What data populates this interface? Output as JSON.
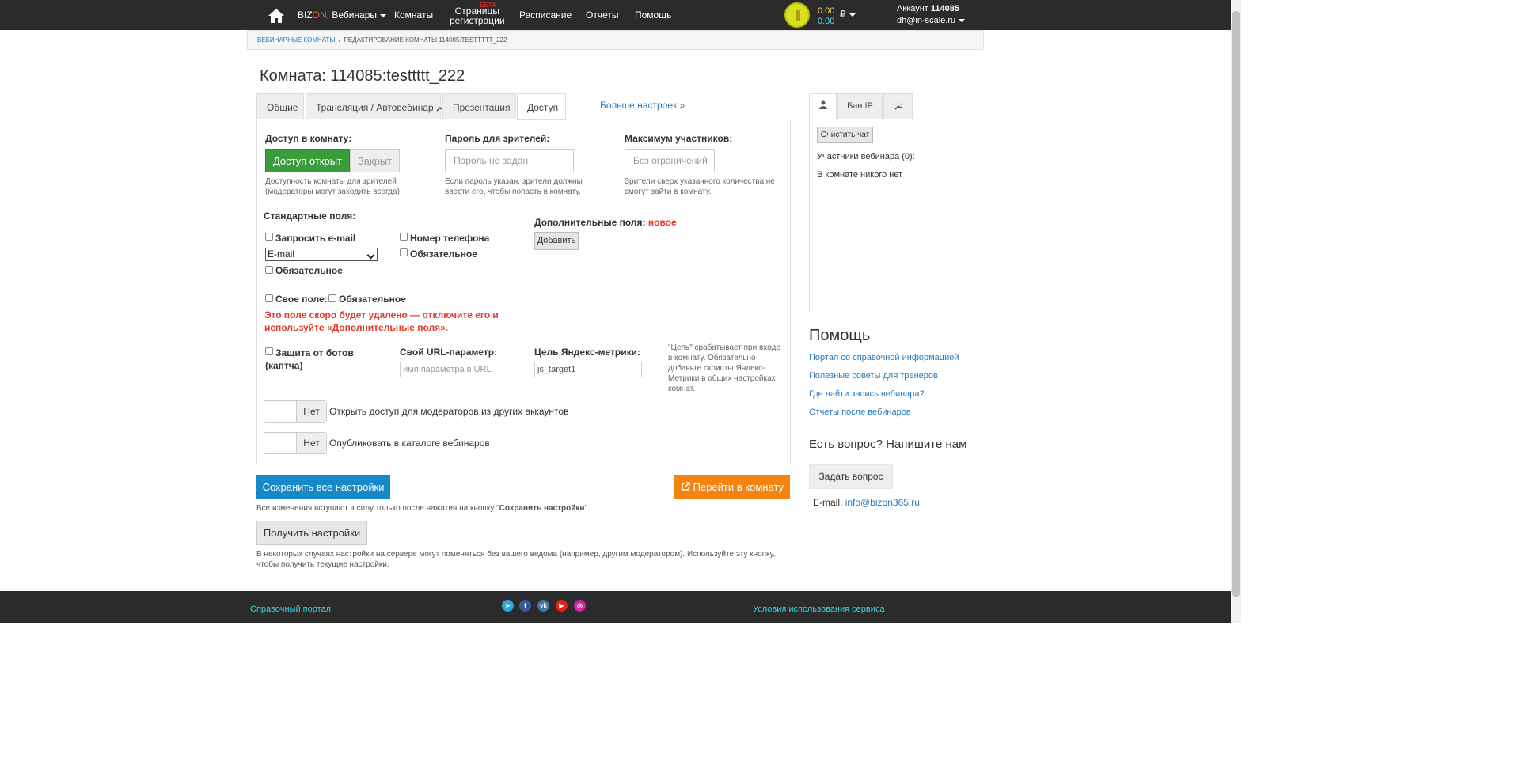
{
  "topnav": {
    "brand_biz": "BIZ",
    "brand_on": "ON",
    "brand_rest": ". Вебинары",
    "rooms": "Комнаты",
    "reg_line1": "Страницы",
    "reg_line2": "регистрации",
    "beta": "БЕТА",
    "schedule": "Расписание",
    "reports": "Отчеты",
    "help": "Помощь",
    "balance1": "0.00",
    "balance2": "0.00",
    "currency": "₽",
    "account_label": "Аккаунт",
    "account_id": "114085",
    "account_email": "dh@in-scale.ru"
  },
  "breadcrumb": {
    "item1": "ВЕБИНАРНЫЕ КОМНАТЫ",
    "sep": "/",
    "item2": "РЕДАКТИРОВАНИЕ КОМНАТЫ 114085:TESTTTTT_222"
  },
  "page_title": "Комната: 114085:testtttt_222",
  "tabs": [
    {
      "label": "Общие"
    },
    {
      "label": "Трансляция / Автовебинар"
    },
    {
      "label": "Презентация"
    },
    {
      "label": "Доступ"
    }
  ],
  "more_settings": "Больше настроек »",
  "access": {
    "label": "Доступ в комнату:",
    "open": "Доступ открыт",
    "closed": "Закрыт",
    "help1": "Доступность комнаты для зрителей",
    "help2": "(модераторы могут заходить всегда)"
  },
  "password": {
    "label": "Пароль для зрителей:",
    "placeholder": "Пароль не задан",
    "help1": "Если пароль указан, зрители должны",
    "help2": "ввести его, чтобы попасть в комнату."
  },
  "max": {
    "label": "Максимум участников:",
    "placeholder": "Без ограничений",
    "help1": "Зрители сверх указанного количества не",
    "help2": "смогут зайти в комнату."
  },
  "standard_fields": {
    "label": "Стандартные поля:",
    "request_email": "Запросить e-mail",
    "email_select": "E-mail",
    "required": "Обязательное",
    "phone": "Номер телефона",
    "phone_required": "Обязательное",
    "own_field": "Свое поле:",
    "own_required": "Обязательное",
    "warn1": "Это поле скоро будет удалено — отключите его и",
    "warn2": "используйте «Дополнительные поля»."
  },
  "extra_fields": {
    "label": "Дополнительные поля:",
    "badge": "новое",
    "add": "Добавить"
  },
  "captcha": {
    "line1": "Защита от ботов",
    "line2": "(каптча)"
  },
  "url_param": {
    "label": "Свой URL-параметр:",
    "placeholder": "имя параметра в URL"
  },
  "metrika": {
    "label": "Цель Яндекс-метрики:",
    "value": "js_target1",
    "help1": "\"Цель\" срабатывает при входе",
    "help2": "в комнату. Обязательно",
    "help3": "добавьте скрипты Яндекс-",
    "help4": "Метрики в общих настройках",
    "help5": "комнат."
  },
  "toggles": [
    {
      "state": "Нет",
      "label": "Открыть доступ для модераторов из других аккаунтов"
    },
    {
      "state": "Нет",
      "label": "Опубликовать в каталоге вебинаров"
    }
  ],
  "actions": {
    "save": "Сохранить все настройки",
    "go_room": "Перейти в комнату",
    "note_prefix": "Все изменения вступают в силу только после нажатия на кнопку \"",
    "note_bold": "Сохранить настройки",
    "note_suffix": "\".",
    "get": "Получить настройки",
    "get_note1": "В некоторых случаях настройки на сервере могут поменяться без вашего ведома (например, другим модератором). Используйте эту кнопку,",
    "get_note2": "чтобы получить текущие настройки."
  },
  "right": {
    "tab_ban": "Бан IP",
    "clear_chat": "Очистить чат",
    "participants": "Участники вебинара (0):",
    "empty": "В комнате никого нет"
  },
  "help_block": {
    "title": "Помощь",
    "links": [
      "Портал со справочной информацией",
      "Полезные советы для тренеров",
      "Где найти запись вебинара?",
      "Отчеты после вебинаров"
    ],
    "ask_title": "Есть вопрос? Напишите нам",
    "ask_button": "Задать вопрос",
    "email_label": "E-mail:",
    "email": "info@bizon365.ru"
  },
  "footer": {
    "left": "Справочный портал",
    "right": "Условия использования сервиса"
  },
  "colors": {
    "topbar": "#2b2b2b",
    "green": "#3b9c3b",
    "save_blue": "#1789c9",
    "orange": "#f4830f",
    "warn_red": "#e03a2a",
    "link": "#2a7bbf"
  }
}
